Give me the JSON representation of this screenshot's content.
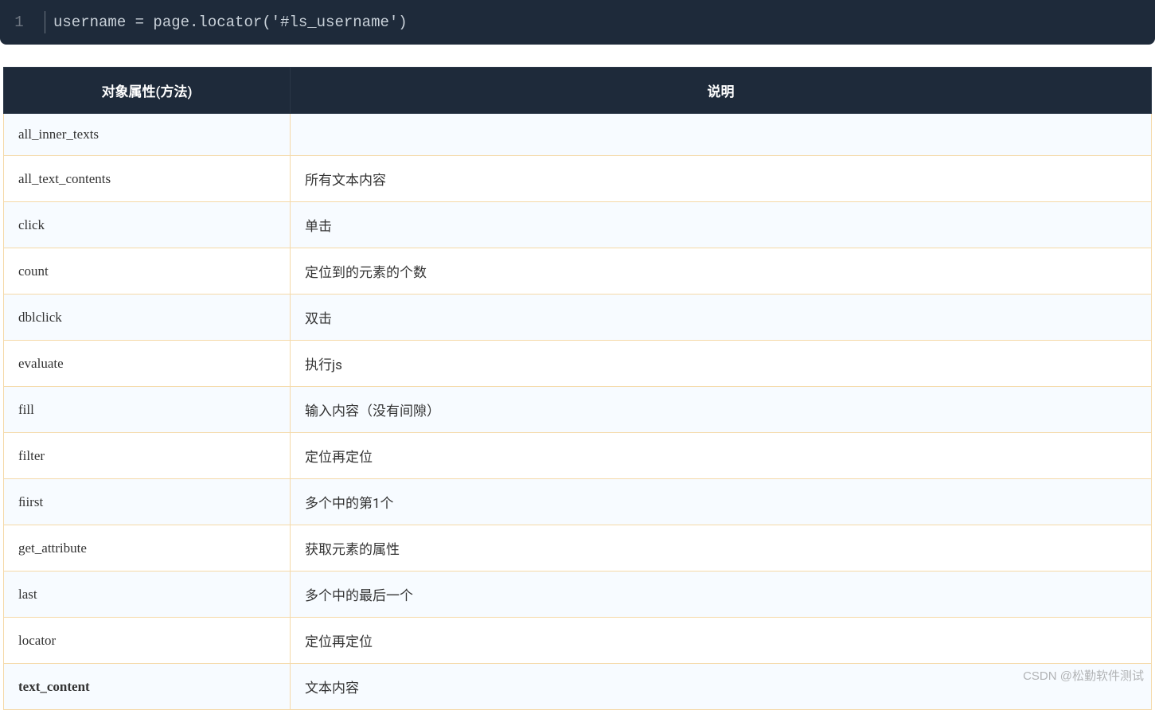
{
  "code": {
    "line_number": "1",
    "content": "username = page.locator('#ls_username')"
  },
  "table": {
    "headers": [
      "对象属性(方法)",
      "说明"
    ],
    "rows": [
      {
        "property": "all_inner_texts",
        "description": "",
        "bold": false
      },
      {
        "property": "all_text_contents",
        "description": "所有文本内容",
        "bold": false
      },
      {
        "property": "click",
        "description": "单击",
        "bold": false
      },
      {
        "property": "count",
        "description": "定位到的元素的个数",
        "bold": false
      },
      {
        "property": "dblclick",
        "description": "双击",
        "bold": false
      },
      {
        "property": "evaluate",
        "description": "执行js",
        "bold": false
      },
      {
        "property": "fill",
        "description": "输入内容（没有间隙）",
        "bold": false
      },
      {
        "property": "filter",
        "description": "定位再定位",
        "bold": false
      },
      {
        "property": "ﬁirst",
        "description": "多个中的第1个",
        "bold": false
      },
      {
        "property": "get_attribute",
        "description": "获取元素的属性",
        "bold": false
      },
      {
        "property": "last",
        "description": "多个中的最后一个",
        "bold": false
      },
      {
        "property": "locator",
        "description": "定位再定位",
        "bold": false
      },
      {
        "property": "text_content",
        "description": "文本内容",
        "bold": true
      }
    ]
  },
  "watermark": "CSDN @松勤软件测试"
}
